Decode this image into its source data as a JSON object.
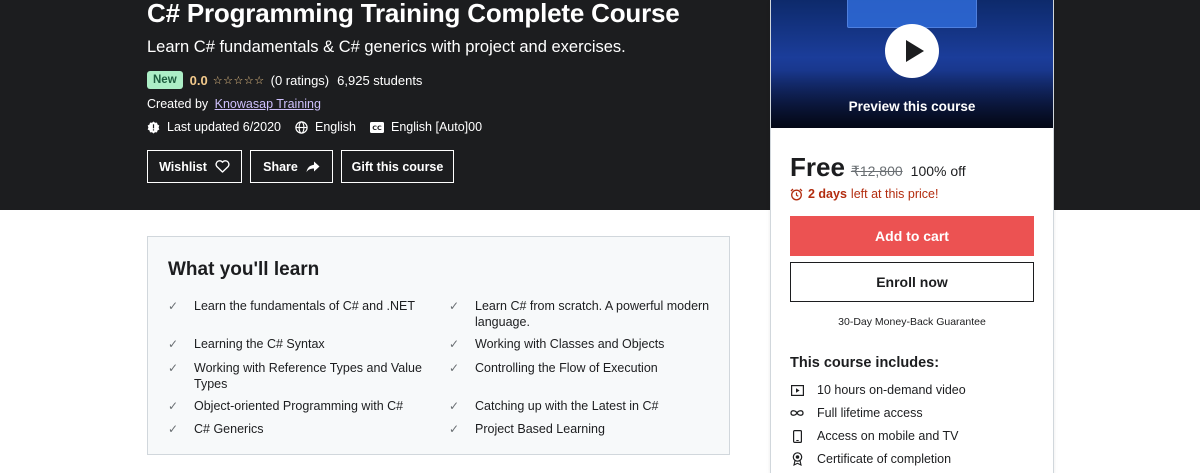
{
  "course": {
    "title": "C# Programming Training Complete Course",
    "subtitle": "Learn C# fundamentals & C# generics with project and exercises.",
    "badge": "New",
    "rating": "0.0",
    "stars_filled": 0,
    "stars_total": 5,
    "ratings_count": "(0 ratings)",
    "students": "6,925 students",
    "created_by_label": "Created by",
    "instructor": "Knowasap Training",
    "last_updated": "Last updated 6/2020",
    "language": "English",
    "captions": "English [Auto]00"
  },
  "actions": {
    "wishlist": "Wishlist",
    "share": "Share",
    "gift": "Gift this course"
  },
  "learn": {
    "title": "What you'll learn",
    "items": [
      "Learn the fundamentals of C# and .NET",
      "Learn C# from scratch. A powerful modern language.",
      "Learning the C# Syntax",
      "Working with Classes and Objects",
      "Working with Reference Types and Value Types",
      "Controlling the Flow of Execution",
      "Object-oriented Programming with C#",
      "Catching up with the Latest in C#",
      "C# Generics",
      "Project Based Learning"
    ]
  },
  "sidebar": {
    "preview_label": "Preview this course",
    "price": "Free",
    "original_price": "₹12,800",
    "discount": "100% off",
    "timer_days": "2 days",
    "timer_text": "left at this price!",
    "add_to_cart": "Add to cart",
    "enroll_now": "Enroll now",
    "guarantee": "30-Day Money-Back Guarantee",
    "includes_title": "This course includes:",
    "includes": [
      {
        "icon": "video-icon",
        "label": "10 hours on-demand video"
      },
      {
        "icon": "infinity-icon",
        "label": "Full lifetime access"
      },
      {
        "icon": "mobile-icon",
        "label": "Access on mobile and TV"
      },
      {
        "icon": "certificate-icon",
        "label": "Certificate of completion"
      }
    ]
  },
  "colors": {
    "hero_bg": "#1c1d1f",
    "badge_bg": "#aceec6",
    "rating_gold": "#f3ca8c",
    "link_purple": "#cec0fc",
    "cart_red": "#ec5252",
    "timer_red": "#b32d0f"
  }
}
